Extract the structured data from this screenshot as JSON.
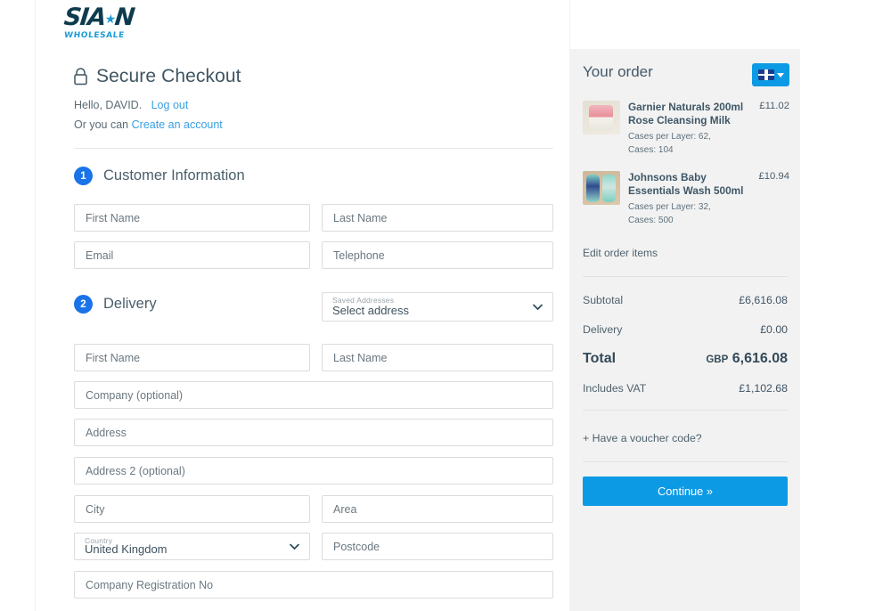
{
  "brand": {
    "name": "SIAN",
    "tagline": "WHOLESALE"
  },
  "header": {
    "title": "Secure Checkout",
    "greeting": "Hello, DAVID.",
    "logout_label": "Log out",
    "or_prefix": "Or you can ",
    "create_account_label": "Create an account"
  },
  "sections": {
    "customer": {
      "number": "1",
      "title": "Customer Information"
    },
    "delivery": {
      "number": "2",
      "title": "Delivery"
    }
  },
  "customer_fields": [
    {
      "name": "first-name",
      "placeholder": "First Name",
      "value": ""
    },
    {
      "name": "last-name",
      "placeholder": "Last Name",
      "value": ""
    },
    {
      "name": "email",
      "placeholder": "Email",
      "value": ""
    },
    {
      "name": "telephone",
      "placeholder": "Telephone",
      "value": ""
    }
  ],
  "saved_addresses": {
    "label": "Saved Addresses",
    "selected": "Select address"
  },
  "delivery_fields": [
    {
      "name": "first-name",
      "placeholder": "First Name",
      "value": ""
    },
    {
      "name": "last-name",
      "placeholder": "Last Name",
      "value": ""
    },
    {
      "name": "company",
      "placeholder": "Company (optional)",
      "value": ""
    },
    {
      "name": "address",
      "placeholder": "Address",
      "value": ""
    },
    {
      "name": "address2",
      "placeholder": "Address 2 (optional)",
      "value": ""
    },
    {
      "name": "city",
      "placeholder": "City",
      "value": ""
    },
    {
      "name": "area",
      "placeholder": "Area",
      "value": ""
    },
    {
      "name": "postcode",
      "placeholder": "Postcode",
      "value": ""
    },
    {
      "name": "company-registration",
      "placeholder": "Company Registration No",
      "value": ""
    }
  ],
  "country": {
    "label": "Country",
    "selected": "United Kingdom"
  },
  "summary": {
    "title": "Your order",
    "currency_flag": "uk-flag-icon",
    "items": [
      {
        "name": "Garnier Naturals 200ml Rose Cleansing Milk",
        "price": "£11.02",
        "cases_per_layer": "Cases per Layer: 62,",
        "cases": "Cases: 104"
      },
      {
        "name": "Johnsons Baby Essentials Wash 500ml",
        "price": "£10.94",
        "cases_per_layer": "Cases per Layer: 32,",
        "cases": "Cases: 500"
      }
    ],
    "edit_label": "Edit order items",
    "subtotal_label": "Subtotal",
    "subtotal_value": "£6,616.08",
    "delivery_label": "Delivery",
    "delivery_value": "£0.00",
    "total_label": "Total",
    "total_currency": "GBP",
    "total_value": "6,616.08",
    "vat_label": "Includes VAT",
    "vat_value": "£1,102.68",
    "voucher_label": "+ Have a voucher code?",
    "continue_label": "Continue »"
  },
  "colors": {
    "accent_blue": "#0d9ae5",
    "badge_blue": "#1a73e8",
    "link_blue": "#3a9fe0",
    "logo_navy": "#0f3b4f",
    "panel_grey": "#f2f2f2"
  }
}
